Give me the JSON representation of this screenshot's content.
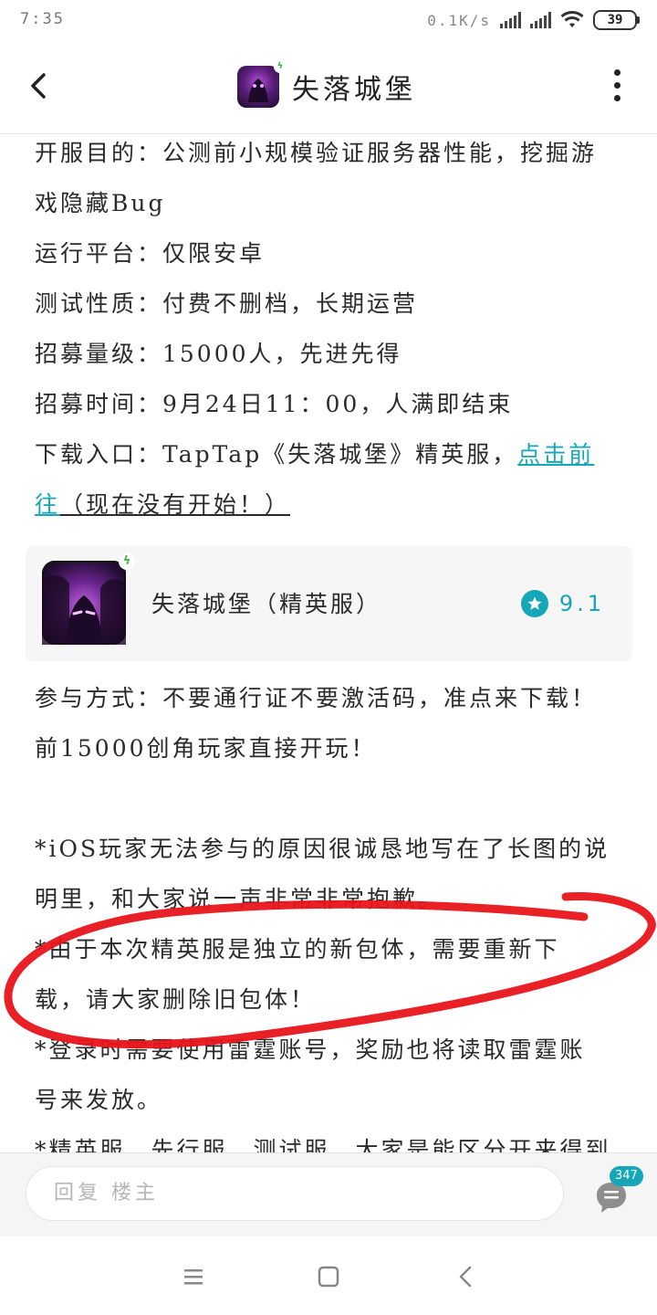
{
  "status_bar": {
    "time": "7:35",
    "net_speed": "0.1K/s",
    "battery": "39"
  },
  "nav": {
    "title": "失落城堡",
    "back_icon": "chevron-left-icon",
    "more_icon": "more-vertical-icon"
  },
  "post": {
    "lines": [
      "开服目的：公测前小规模验证服务器性能，挖掘游",
      "戏隐藏Bug",
      "运行平台：仅限安卓",
      "测试性质：付费不删档，长期运营",
      "招募量级：15000人，先进先得",
      "招募时间：9月24日11：00，人满即结束"
    ],
    "download_prefix": "下载入口：TapTap《失落城堡》精英服，",
    "download_link_part1": "点击前",
    "download_link_part2": "往",
    "download_note": "（现在没有开始！）"
  },
  "app_card": {
    "name": "失落城堡（精英服）",
    "rating": "9.1",
    "star_color": "#15a6b8"
  },
  "post2": {
    "lines": [
      "参与方式：不要通行证不要激活码，准点来下载！",
      "前15000创角玩家直接开玩！",
      "",
      "*iOS玩家无法参与的原因很诚恳地写在了长图的说",
      "明里，和大家说一声非常非常抱歉。",
      "*由于本次精英服是独立的新包体，需要重新下",
      "载，请大家删除旧包体！",
      "*登录时需要使用雷霆账号，奖励也将读取雷霆账",
      "号来发放。",
      "*精英服、先行服、测试服，大家是能区分开来得到"
    ]
  },
  "reply_bar": {
    "placeholder": "回复  楼主",
    "comment_count": "347"
  },
  "colors": {
    "accent": "#15a6b8",
    "annotation": "#e8141a"
  }
}
